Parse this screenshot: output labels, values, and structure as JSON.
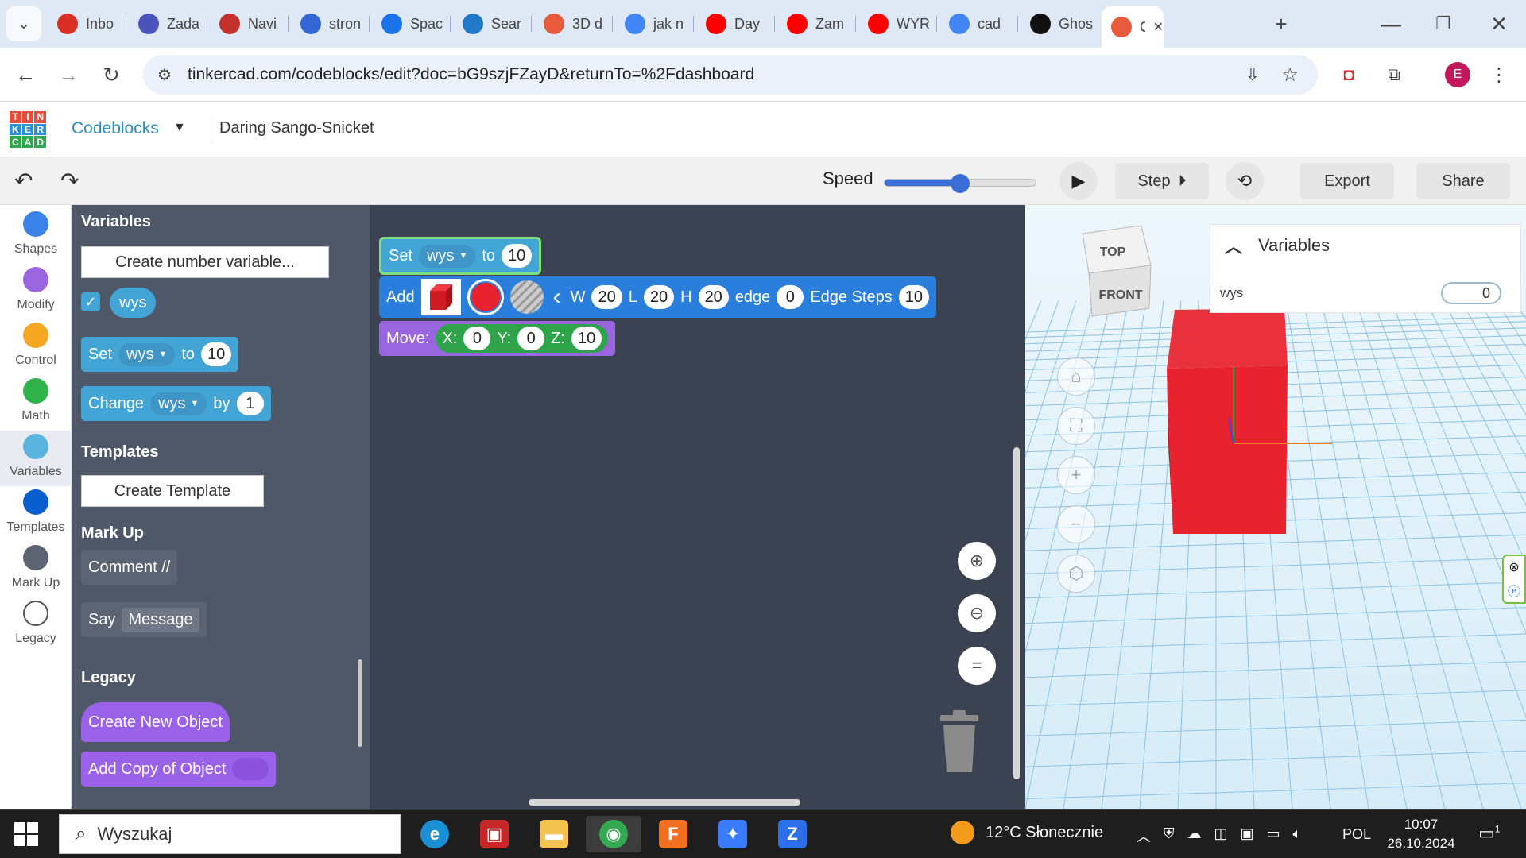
{
  "browser": {
    "tabs": [
      {
        "label": "Inbo",
        "icon": "gmail-icon",
        "color": "#d93025"
      },
      {
        "label": "Zada",
        "icon": "teams-icon",
        "color": "#4b53bc"
      },
      {
        "label": "Navi",
        "icon": "youtube-outline-icon",
        "color": "#c4302b"
      },
      {
        "label": "stron",
        "icon": "google-sites-icon",
        "color": "#3367d6"
      },
      {
        "label": "Spac",
        "icon": "globe-icon",
        "color": "#1a73e8"
      },
      {
        "label": "Sear",
        "icon": "teams-search-icon",
        "color": "#1f78c8"
      },
      {
        "label": "3D d",
        "icon": "tinkercad-icon",
        "color": "#e85a3c"
      },
      {
        "label": "jak n",
        "icon": "google-icon",
        "color": "#4285f4"
      },
      {
        "label": "Day",
        "icon": "youtube-icon",
        "color": "#ff0000"
      },
      {
        "label": "Zam",
        "icon": "youtube-icon",
        "color": "#ff0000"
      },
      {
        "label": "WYR",
        "icon": "youtube-icon",
        "color": "#ff0000"
      },
      {
        "label": "cad",
        "icon": "google-icon",
        "color": "#4285f4"
      },
      {
        "label": "Ghos",
        "icon": "github-icon",
        "color": "#111111"
      },
      {
        "label": "C",
        "icon": "tinkercad-icon",
        "color": "#e85a3c"
      }
    ],
    "url": "tinkercad.com/codeblocks/edit?doc=bG9szjFZayD&returnTo=%2Fdashboard",
    "profile_initial": "E"
  },
  "app": {
    "logo_letters": [
      "T",
      "I",
      "N",
      "K",
      "E",
      "R",
      "C",
      "A",
      "D"
    ],
    "section_title": "Codeblocks",
    "project_name": "Daring Sango-Snicket"
  },
  "toolbar": {
    "speed_label": "Speed",
    "speed_value": 0.5,
    "step_label": "Step",
    "export_label": "Export",
    "share_label": "Share"
  },
  "categories": [
    {
      "label": "Shapes",
      "color": "#3b82e8"
    },
    {
      "label": "Modify",
      "color": "#9966e0"
    },
    {
      "label": "Control",
      "color": "#f5a623"
    },
    {
      "label": "Math",
      "color": "#2fb34a"
    },
    {
      "label": "Variables",
      "color": "#5bb3e0"
    },
    {
      "label": "Templates",
      "color": "#0a5fd0"
    },
    {
      "label": "Mark Up",
      "color": "#5c6473"
    },
    {
      "label": "Legacy",
      "color": "#ffffff"
    }
  ],
  "flyout": {
    "variables_heading": "Variables",
    "create_variable_btn": "Create number variable...",
    "variable_name": "wys",
    "set_block": {
      "label": "Set",
      "var": "wys",
      "to": "to",
      "value": "10"
    },
    "change_block": {
      "label": "Change",
      "var": "wys",
      "by": "by",
      "value": "1"
    },
    "templates_heading": "Templates",
    "create_template_btn": "Create Template",
    "markup_heading": "Mark Up",
    "comment_block": "Comment //",
    "say_block": {
      "label": "Say",
      "message": "Message"
    },
    "legacy_heading": "Legacy",
    "create_new_object": "Create New Object",
    "add_copy_object": "Add Copy of Object"
  },
  "workspace": {
    "set_block": {
      "label": "Set",
      "var": "wys",
      "to": "to",
      "value": "10"
    },
    "add_block": {
      "label": "Add",
      "w_label": "W",
      "w": "20",
      "l_label": "L",
      "l": "20",
      "h_label": "H",
      "h": "20",
      "edge_label": "edge",
      "edge": "0",
      "steps_label": "Edge Steps",
      "steps": "10",
      "color": "#e8232f"
    },
    "move_block": {
      "label": "Move:",
      "x_label": "X:",
      "x": "0",
      "y_label": "Y:",
      "y": "0",
      "z_label": "Z:",
      "z": "10"
    }
  },
  "view3d": {
    "cube_top": "TOP",
    "cube_front": "FRONT",
    "variables_panel_title": "Variables",
    "variable_name": "wys",
    "variable_value": "0"
  },
  "taskbar": {
    "search_placeholder": "Wyszukaj",
    "weather": "12°C  Słonecznie",
    "language": "POL",
    "time": "10:07",
    "date": "26.10.2024",
    "notification_count": "1",
    "apps": [
      {
        "name": "edge-app",
        "color": "#1a8fd4",
        "glyph": "e"
      },
      {
        "name": "gift-app",
        "color": "#c62828",
        "glyph": "▣"
      },
      {
        "name": "file-explorer-app",
        "color": "#f2c14e",
        "glyph": "▬"
      },
      {
        "name": "chrome-app",
        "color": "#34a853",
        "glyph": "◉"
      },
      {
        "name": "fusion-app",
        "color": "#f37021",
        "glyph": "F"
      },
      {
        "name": "copilot-app",
        "color": "#3b7bff",
        "glyph": "✦"
      },
      {
        "name": "zoom-app",
        "color": "#2d6fe8",
        "glyph": "Z"
      }
    ]
  }
}
